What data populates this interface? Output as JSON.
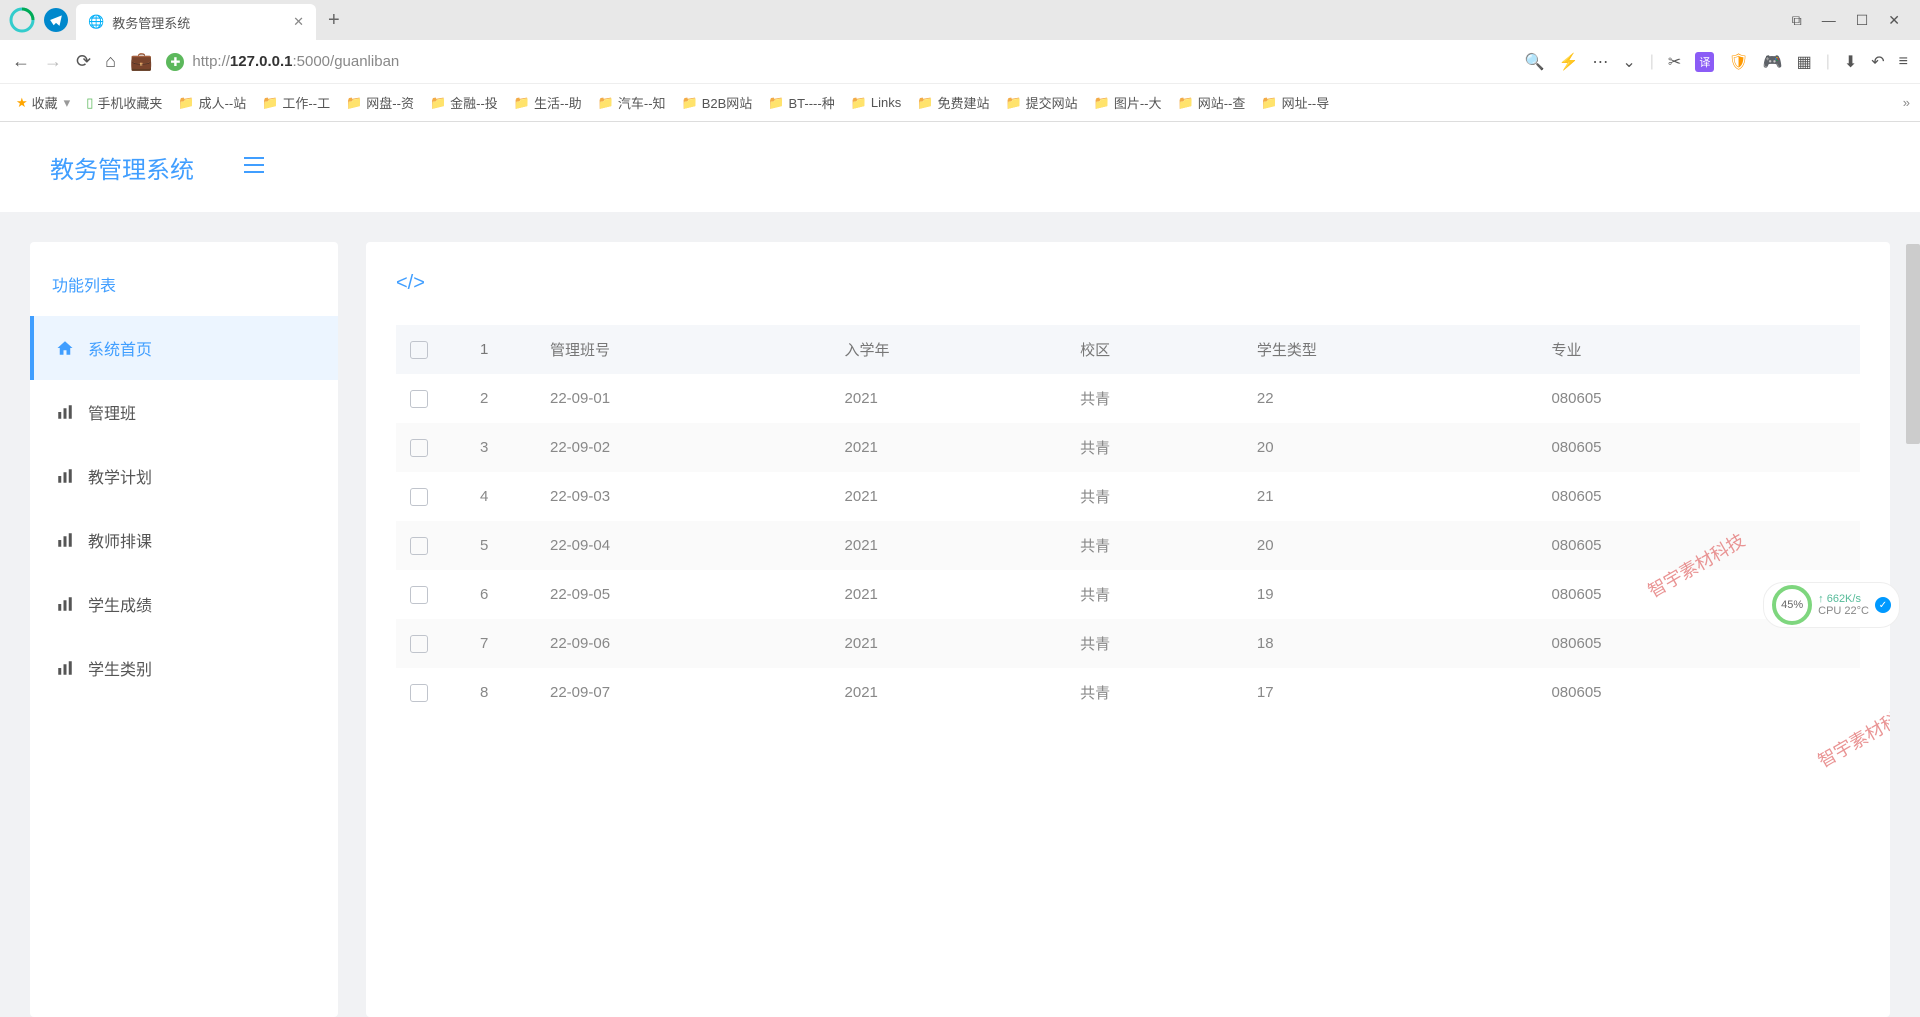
{
  "browser": {
    "tab_title": "教务管理系统",
    "url_display": "http://127.0.0.1:5000/guanliban",
    "url_bold": "127.0.0.1",
    "bookmarks_label": "收藏",
    "mobile_bookmarks": "手机收藏夹",
    "bookmarks": [
      "成人--站",
      "工作--工",
      "网盘--资",
      "金融--投",
      "生活--助",
      "汽车--知",
      "B2B网站",
      "BT----种",
      "Links",
      "免费建站",
      "提交网站",
      "图片--大",
      "网站--查",
      "网址--导"
    ]
  },
  "app": {
    "title": "教务管理系统",
    "sidebar": {
      "title": "功能列表",
      "items": [
        {
          "label": "系统首页",
          "icon": "home"
        },
        {
          "label": "管理班",
          "icon": "bar"
        },
        {
          "label": "教学计划",
          "icon": "bar"
        },
        {
          "label": "教师排课",
          "icon": "bar"
        },
        {
          "label": "学生成绩",
          "icon": "bar"
        },
        {
          "label": "学生类别",
          "icon": "bar"
        }
      ]
    },
    "table": {
      "headers": {
        "num": "1",
        "class_no": "管理班号",
        "year": "入学年",
        "campus": "校区",
        "type": "学生类型",
        "major": "专业"
      },
      "rows": [
        {
          "num": "2",
          "class_no": "22-09-01",
          "year": "2021",
          "campus": "共青",
          "type": "22",
          "major": "080605"
        },
        {
          "num": "3",
          "class_no": "22-09-02",
          "year": "2021",
          "campus": "共青",
          "type": "20",
          "major": "080605"
        },
        {
          "num": "4",
          "class_no": "22-09-03",
          "year": "2021",
          "campus": "共青",
          "type": "21",
          "major": "080605"
        },
        {
          "num": "5",
          "class_no": "22-09-04",
          "year": "2021",
          "campus": "共青",
          "type": "20",
          "major": "080605"
        },
        {
          "num": "6",
          "class_no": "22-09-05",
          "year": "2021",
          "campus": "共青",
          "type": "19",
          "major": "080605"
        },
        {
          "num": "7",
          "class_no": "22-09-06",
          "year": "2021",
          "campus": "共青",
          "type": "18",
          "major": "080605"
        },
        {
          "num": "8",
          "class_no": "22-09-07",
          "year": "2021",
          "campus": "共青",
          "type": "17",
          "major": "080605"
        }
      ]
    }
  },
  "perf": {
    "pct": "45%",
    "net": "662K/s",
    "cpu": "CPU 22°C"
  },
  "watermark": "智宇素材科技"
}
